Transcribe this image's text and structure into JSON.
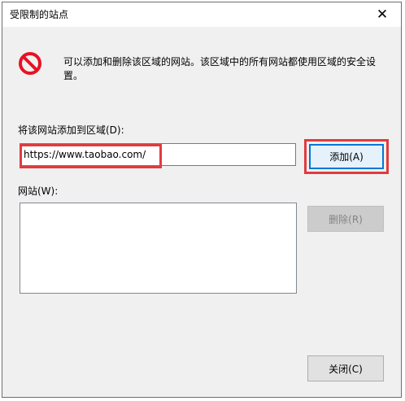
{
  "window": {
    "title": "受限制的站点",
    "close_glyph": "✕"
  },
  "info": {
    "icon": "restricted-icon",
    "text": "可以添加和删除该区域的网站。该区域中的所有网站都使用区域的安全设置。"
  },
  "add_section": {
    "label": "将该网站添加到区域(D):",
    "input_value": "https://www.taobao.com/",
    "add_button": "添加(A)"
  },
  "sites_section": {
    "label": "网站(W):",
    "items": [],
    "delete_button": "删除(R)"
  },
  "footer": {
    "close_button": "关闭(C)"
  },
  "colors": {
    "highlight": "#e13b3f",
    "focus_border": "#0078d7",
    "restricted_red": "#e81123"
  }
}
